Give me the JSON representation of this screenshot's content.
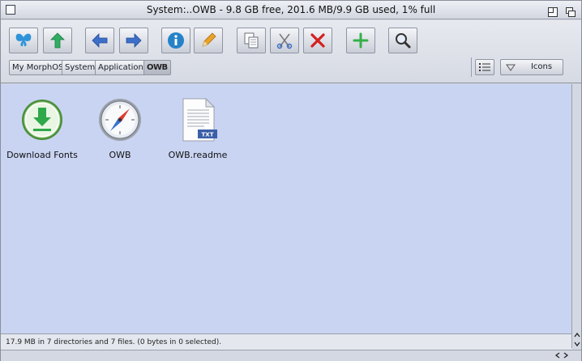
{
  "window": {
    "title": "System:..OWB - 9.8 GB free, 201.6 MB/9.9 GB used, 1% full"
  },
  "toolbar": {
    "buttons": [
      {
        "name": "butterfly-icon",
        "color": "#2f93d9"
      },
      {
        "name": "parent-arrow-up-icon",
        "color": "#2fae62"
      },
      {
        "name": "back-arrow-icon",
        "color": "#3c6fc9"
      },
      {
        "name": "forward-arrow-icon",
        "color": "#3c6fc9"
      },
      {
        "name": "info-icon",
        "color": "#2582c9"
      },
      {
        "name": "rename-pencil-icon",
        "color": "#e9a326"
      },
      {
        "name": "copy-icon",
        "color": "#6a6f7a"
      },
      {
        "name": "cut-scissors-icon",
        "color": "#3c6fc9"
      },
      {
        "name": "delete-x-icon",
        "color": "#d42020"
      },
      {
        "name": "new-plus-icon",
        "color": "#35b04a"
      },
      {
        "name": "search-magnifier-icon",
        "color": "#333333"
      }
    ]
  },
  "breadcrumbs": [
    {
      "label": "My MorphOS"
    },
    {
      "label": "System:"
    },
    {
      "label": "Applications"
    },
    {
      "label": "OWB"
    }
  ],
  "view": {
    "mode_label": "Icons"
  },
  "files": [
    {
      "label": "Download Fonts",
      "icon": "download-icon"
    },
    {
      "label": "OWB",
      "icon": "compass-icon"
    },
    {
      "label": "OWB.readme",
      "icon": "text-document-icon",
      "badge": "TXT"
    }
  ],
  "status": {
    "text": "17.9 MB in 7 directories and 7 files. (0 bytes in 0 selected)."
  }
}
